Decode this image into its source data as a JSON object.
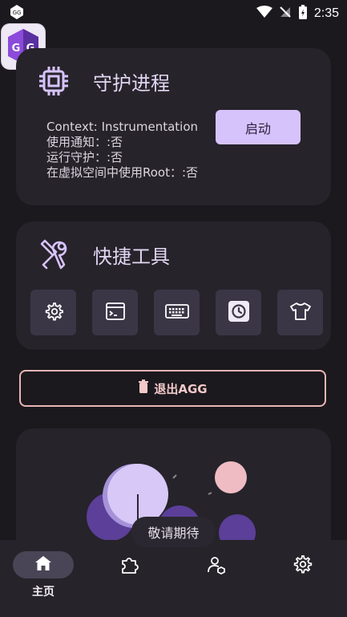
{
  "status_bar": {
    "time": "2:35"
  },
  "guard_card": {
    "title": "守护进程",
    "info_lines": [
      "Context: Instrumentation",
      "使用通知：:否",
      "运行守护：:否",
      "在虚拟空间中使用Root：:否"
    ],
    "start_label": "启动"
  },
  "tools_card": {
    "title": "快捷工具",
    "tools": [
      "gear-icon",
      "terminal-icon",
      "keyboard-icon",
      "history-icon",
      "shirt-icon"
    ]
  },
  "exit_label": "退出AGG",
  "tooltip": "敬请期待",
  "bottom_nav": [
    {
      "label": "主页",
      "icon": "home-icon"
    },
    {
      "label": "",
      "icon": "puzzle-icon"
    },
    {
      "label": "",
      "icon": "user-manage-icon"
    },
    {
      "label": "",
      "icon": "settings-icon"
    }
  ],
  "colors": {
    "accent": "#d7c3fb",
    "card": "#26232a",
    "background": "#1b191e",
    "exit_border": "#eab5b5"
  }
}
